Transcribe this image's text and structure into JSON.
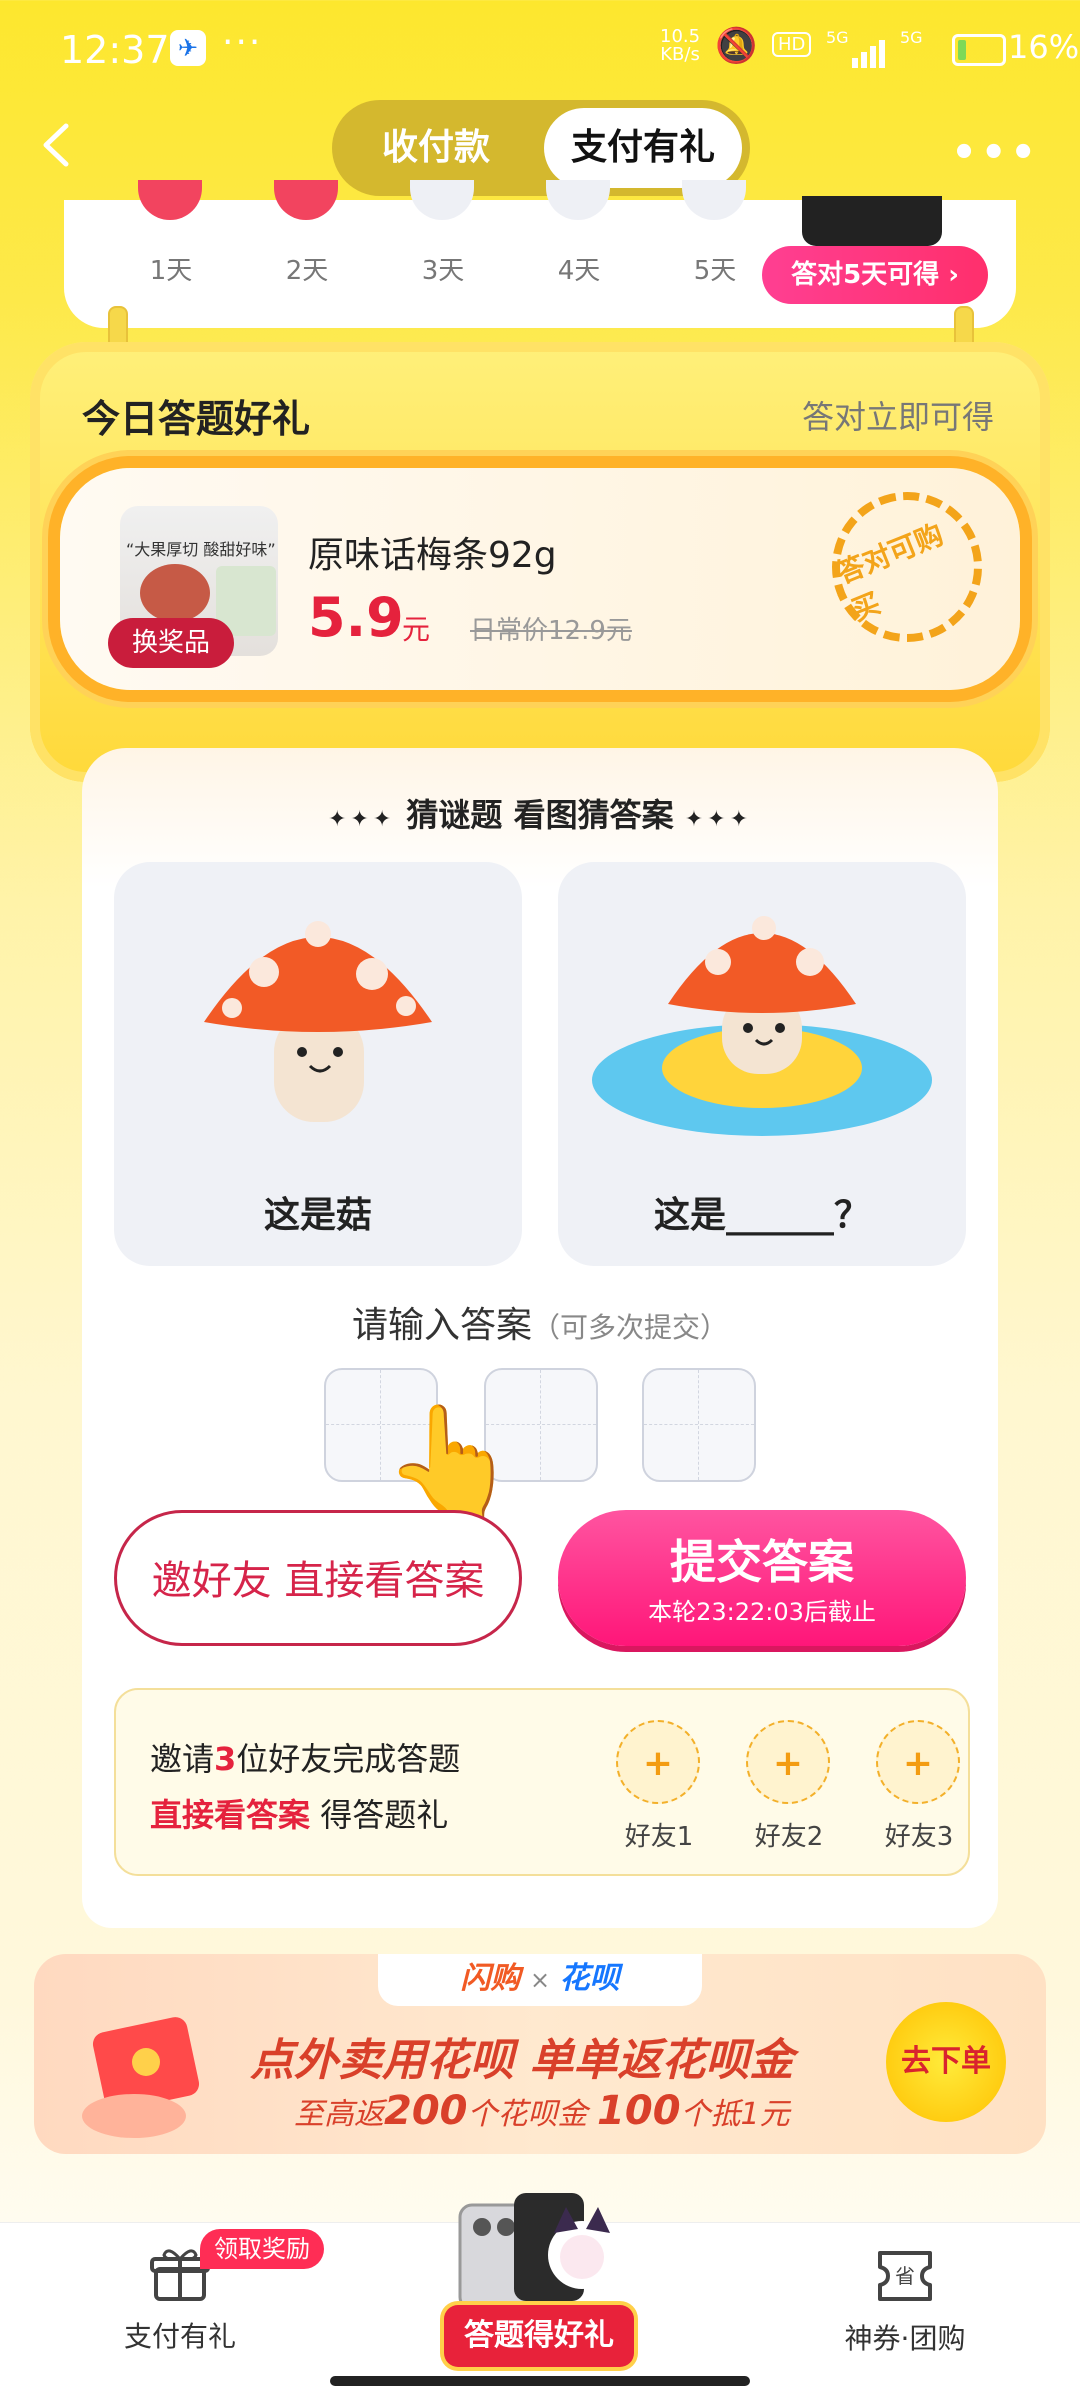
{
  "status_bar": {
    "time": "12:37",
    "dots": "···",
    "net_speed": "10.5\nKB/s",
    "hd": "HD",
    "signal1": "5G",
    "signal2": "5G",
    "battery": "16%"
  },
  "header": {
    "tabs": [
      {
        "label": "收付款",
        "active": false
      },
      {
        "label": "支付有礼",
        "active": true
      }
    ],
    "more": "•••"
  },
  "checkin": {
    "days": [
      "1天",
      "2天",
      "3天",
      "4天",
      "5天"
    ],
    "completed_days": 2,
    "reward_pill": "答对5天可得 ›"
  },
  "quiz_reward": {
    "title": "今日答题好礼",
    "subtitle": "答对立即可得",
    "product": {
      "tagline": "“大果厚切 酸甜好味”",
      "badge": "换奖品",
      "name": "原味话梅条92g",
      "price": "5.9",
      "price_unit": "元",
      "old_price": "日常价12.9元",
      "stamp": "答对可购买"
    }
  },
  "riddle": {
    "title": "猜谜题 看图猜答案",
    "sparkle_left": "✦✦✦",
    "sparkle_right": "✦✦✦",
    "pictures": [
      {
        "caption": "这是菇"
      },
      {
        "caption": "这是______？"
      }
    ],
    "answer_prompt": "请输入答案",
    "answer_hint": "（可多次提交）",
    "answer_length": 3,
    "invite_button": "邀好友 直接看答案",
    "submit_label": "提交答案",
    "submit_deadline": "本轮23:22:03后截止",
    "invite_panel": {
      "line1_prefix": "邀请",
      "line1_num": "3",
      "line1_suffix": "位好友完成答题",
      "line2_red": "直接看答案",
      "line2_rest": " 得答题礼",
      "friends": [
        "好友1",
        "好友2",
        "好友3"
      ]
    }
  },
  "promo": {
    "brand1": "闪购",
    "x": "×",
    "brand2": "花呗",
    "headline": "点外卖用花呗 单单返花呗金",
    "sub_prefix": "至高返",
    "sub_num1": "200",
    "sub_mid": "个花呗金 ",
    "sub_num2": "100",
    "sub_suffix": "个抵1元",
    "cta": "去下单"
  },
  "bottom_nav": {
    "items": [
      {
        "label": "支付有礼"
      },
      {
        "label": "答题得好礼"
      },
      {
        "label": "神券·团购"
      }
    ],
    "badge": "领取奖励"
  },
  "colors": {
    "brand_yellow": "#fde72e",
    "accent_red": "#e5223d",
    "accent_pink": "#ff1679"
  }
}
